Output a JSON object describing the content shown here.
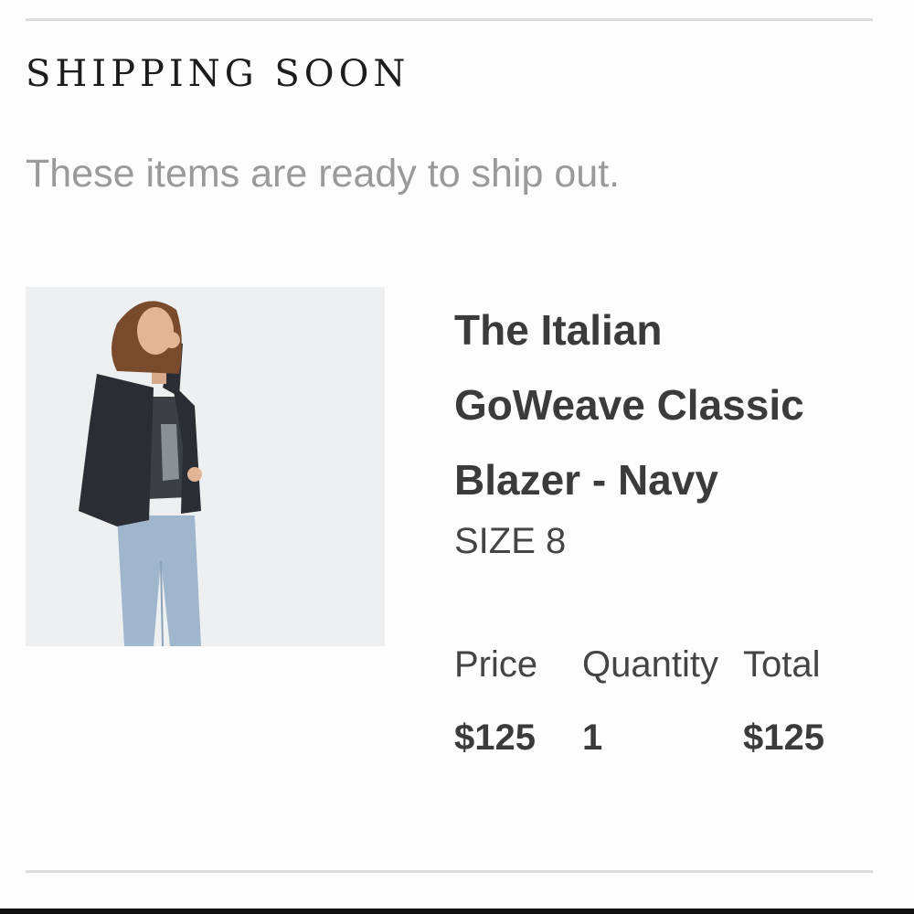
{
  "section": {
    "heading": "SHIPPING SOON",
    "subtext": "These items are ready to ship out."
  },
  "item": {
    "name": "The Italian\nGoWeave Classic\nBlazer - Navy",
    "size": "SIZE 8",
    "image_icon": "product-photo-blazer-model",
    "columns": {
      "price_label": "Price",
      "quantity_label": "Quantity",
      "total_label": "Total"
    },
    "values": {
      "price": "$125",
      "quantity": "1",
      "total": "$125"
    }
  },
  "colors": {
    "heading": "#1c1c1c",
    "subtext": "#9a9a9a",
    "body_text": "#3b3b3b",
    "divider": "#dcdcdc",
    "image_background": "#eeeff1"
  }
}
